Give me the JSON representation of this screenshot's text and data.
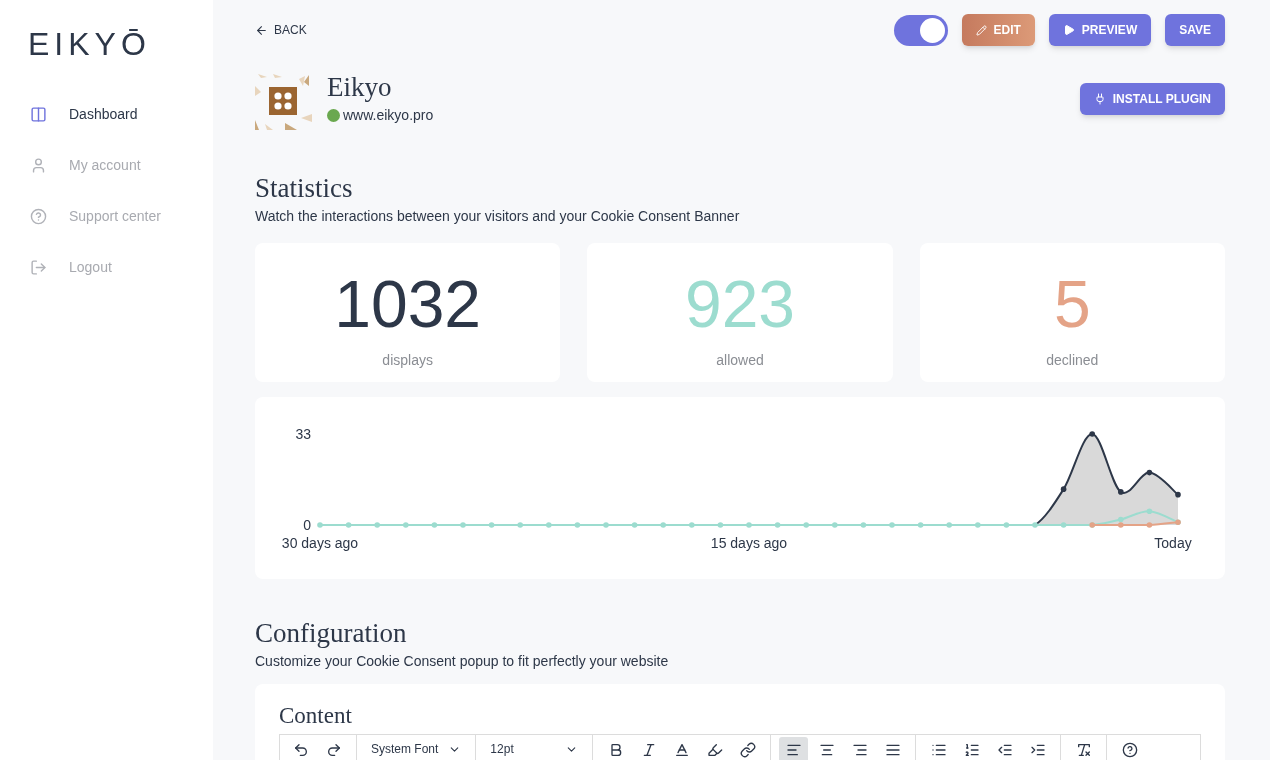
{
  "sidebar": {
    "logo": "EIKYŌ",
    "items": [
      {
        "label": "Dashboard",
        "kind": "dashboard",
        "selected": true
      },
      {
        "label": "My account",
        "kind": "account",
        "selected": false
      },
      {
        "label": "Support center",
        "kind": "support",
        "selected": false
      },
      {
        "label": "Logout",
        "kind": "logout",
        "selected": false
      }
    ]
  },
  "topbar": {
    "back": "BACK",
    "toggle": {
      "on": true
    },
    "buttons": [
      {
        "label": "EDIT",
        "kind": "edit"
      },
      {
        "label": "PREVIEW",
        "kind": "preview"
      },
      {
        "label": "SAVE",
        "kind": "save"
      }
    ]
  },
  "site": {
    "name": "Eikyo",
    "url": "www.eikyo.pro",
    "online": true,
    "install": "INSTALL PLUGIN"
  },
  "statistics": {
    "title": "Statistics",
    "subtitle": "Watch the interactions between your visitors and your Cookie Consent Banner",
    "cards": [
      {
        "value": "1032",
        "label": "displays",
        "color": "#2d3748"
      },
      {
        "value": "923",
        "label": "allowed",
        "color": "#9cdccf"
      },
      {
        "value": "5",
        "label": "declined",
        "color": "#e4a387"
      }
    ],
    "chart_data": {
      "type": "area",
      "categories": [
        "30 days ago",
        null,
        null,
        null,
        null,
        null,
        null,
        null,
        null,
        null,
        null,
        null,
        null,
        null,
        null,
        "15 days ago",
        null,
        null,
        null,
        null,
        null,
        null,
        null,
        null,
        null,
        null,
        null,
        null,
        null,
        null,
        "Today"
      ],
      "yticks": [
        0,
        33
      ],
      "ylim": [
        0,
        33
      ],
      "series": [
        {
          "type": "area",
          "color": "#2d3748",
          "values": [
            null,
            null,
            null,
            null,
            null,
            null,
            null,
            null,
            null,
            null,
            null,
            null,
            null,
            null,
            null,
            null,
            null,
            null,
            null,
            null,
            null,
            null,
            null,
            null,
            null,
            0,
            13,
            33,
            12,
            19,
            11
          ]
        },
        {
          "type": "line",
          "color": "#9cdccf",
          "values": [
            0,
            0,
            0,
            0,
            0,
            0,
            0,
            0,
            0,
            0,
            0,
            0,
            0,
            0,
            0,
            0,
            0,
            0,
            0,
            0,
            0,
            0,
            0,
            0,
            0,
            0,
            0,
            0,
            2,
            5,
            1
          ]
        },
        {
          "type": "line",
          "color": "#e4a387",
          "values": [
            null,
            null,
            null,
            null,
            null,
            null,
            null,
            null,
            null,
            null,
            null,
            null,
            null,
            null,
            null,
            null,
            null,
            null,
            null,
            null,
            null,
            null,
            null,
            null,
            null,
            null,
            null,
            0,
            0,
            0,
            1
          ]
        }
      ]
    }
  },
  "configuration": {
    "title": "Configuration",
    "subtitle": "Customize your Cookie Consent popup to fit perfectly your website",
    "content_title": "Content",
    "toolbar": [
      {
        "kind": "undo",
        "selected": false
      },
      {
        "kind": "redo",
        "selected": false
      },
      {
        "kind": "sep"
      },
      {
        "kind": "select",
        "value": "System Font"
      },
      {
        "kind": "sep"
      },
      {
        "kind": "select",
        "value": "12pt"
      },
      {
        "kind": "sep"
      },
      {
        "kind": "bold",
        "selected": false
      },
      {
        "kind": "italic",
        "selected": false
      },
      {
        "kind": "color",
        "selected": false
      },
      {
        "kind": "highlight",
        "selected": false
      },
      {
        "kind": "link",
        "selected": false
      },
      {
        "kind": "sep"
      },
      {
        "kind": "align-left",
        "selected": true
      },
      {
        "kind": "align-center",
        "selected": false
      },
      {
        "kind": "align-right",
        "selected": false
      },
      {
        "kind": "justify",
        "selected": false
      },
      {
        "kind": "sep"
      },
      {
        "kind": "bullets",
        "selected": false
      },
      {
        "kind": "numbers",
        "selected": false
      },
      {
        "kind": "outdent",
        "selected": false
      },
      {
        "kind": "indent",
        "selected": false
      },
      {
        "kind": "sep"
      },
      {
        "kind": "clear",
        "selected": false
      },
      {
        "kind": "sep"
      },
      {
        "kind": "help",
        "selected": false
      }
    ]
  }
}
